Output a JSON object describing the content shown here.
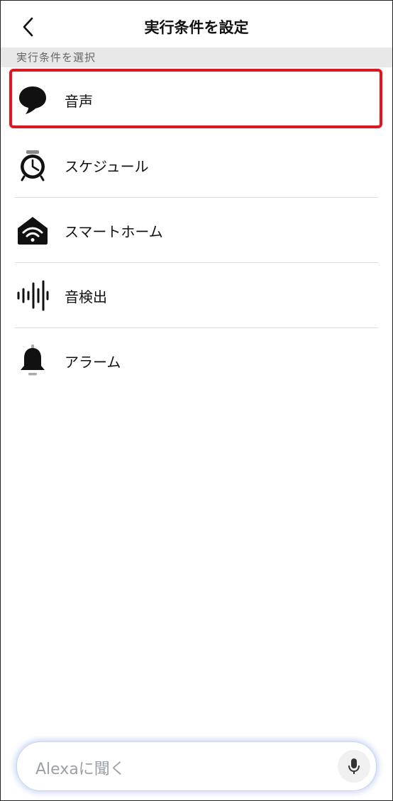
{
  "header": {
    "title": "実行条件を設定"
  },
  "section": {
    "heading": "実行条件を選択"
  },
  "items": [
    {
      "label": "音声",
      "icon": "speech-bubble-icon",
      "selected": true
    },
    {
      "label": "スケジュール",
      "icon": "alarm-clock-icon",
      "selected": false
    },
    {
      "label": "スマートホーム",
      "icon": "smart-home-wifi-icon",
      "selected": false
    },
    {
      "label": "音検出",
      "icon": "sound-wave-icon",
      "selected": false
    },
    {
      "label": "アラーム",
      "icon": "bell-icon",
      "selected": false
    }
  ],
  "bottom_bar": {
    "placeholder": "Alexaに聞く",
    "icon": "microphone-icon"
  },
  "colors": {
    "highlight": "#e8121c",
    "section_bg": "#e8e8e8",
    "text": "#111111"
  }
}
